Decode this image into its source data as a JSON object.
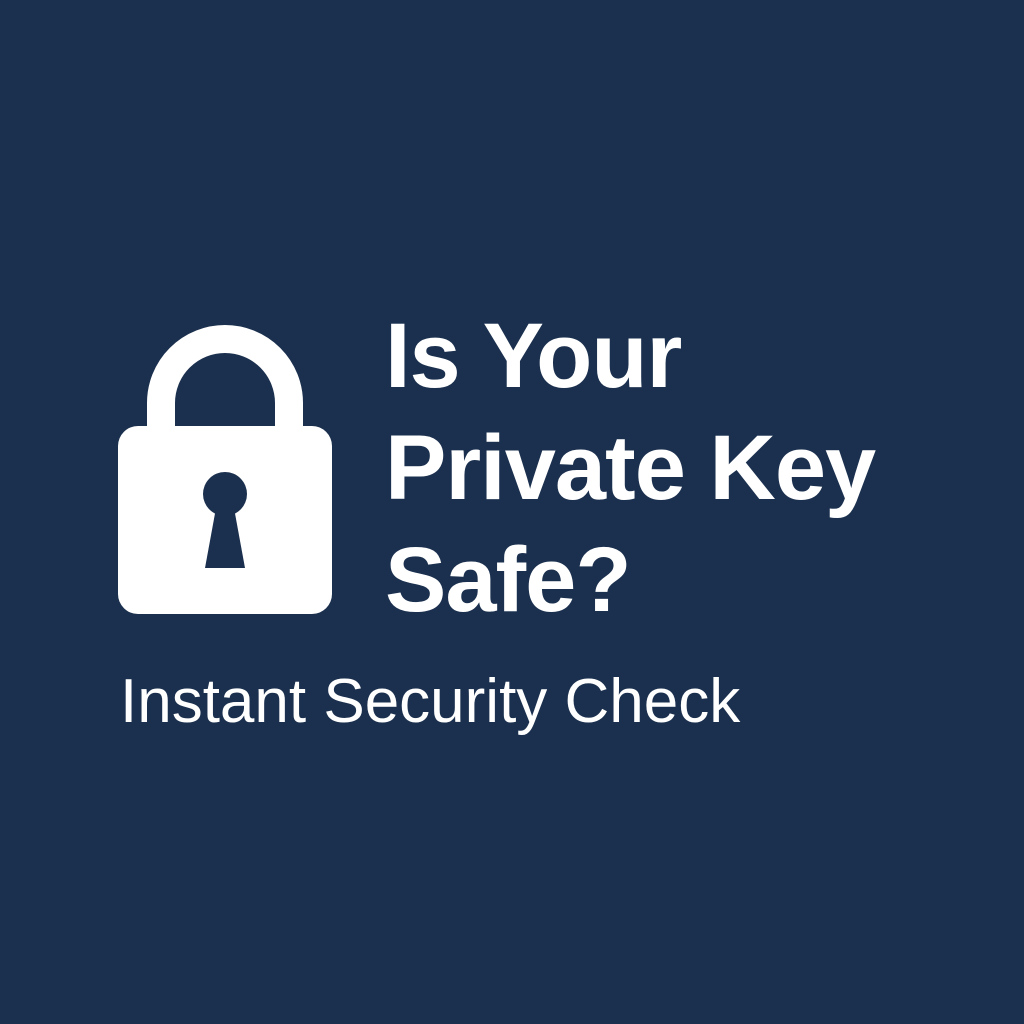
{
  "headline": {
    "line1": "Is Your",
    "line2": "Private Key",
    "line3": "Safe?"
  },
  "subtitle": "Instant Security Check",
  "icon": "padlock-icon",
  "colors": {
    "background": "#1b304e",
    "foreground": "#ffffff"
  }
}
